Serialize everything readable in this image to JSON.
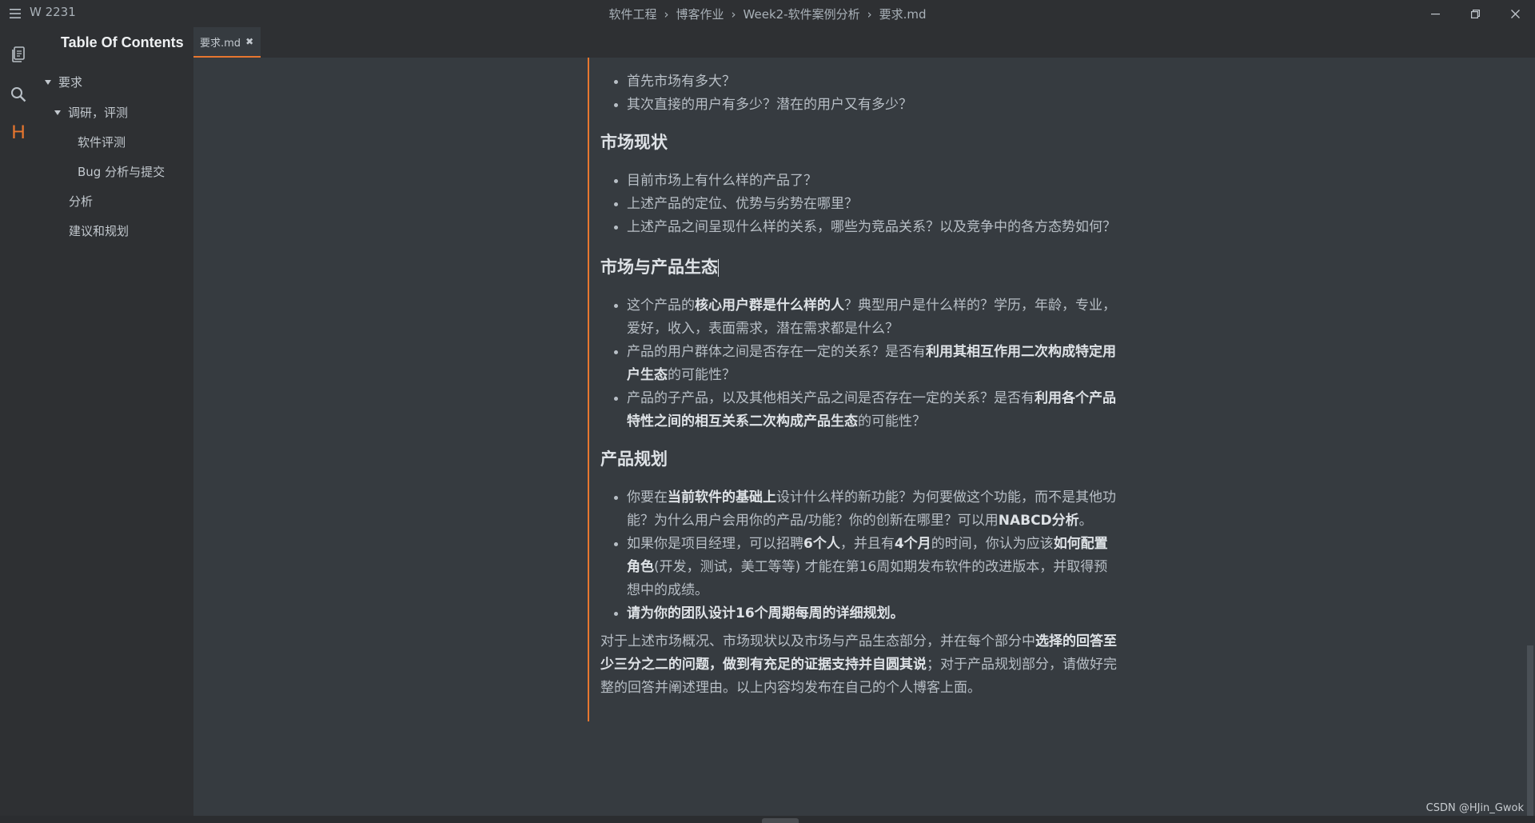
{
  "window": {
    "title": "W 2231",
    "breadcrumb": [
      "软件工程",
      "博客作业",
      "Week2-软件案例分析",
      "要求.md"
    ]
  },
  "sidebar": {
    "title": "Table Of Contents",
    "items": [
      {
        "label": "要求",
        "level": 1,
        "expanded": true
      },
      {
        "label": "调研，评测",
        "level": 2,
        "expanded": true
      },
      {
        "label": "软件评测",
        "level": 3
      },
      {
        "label": "Bug 分析与提交",
        "level": 3
      },
      {
        "label": "分析",
        "level": 2
      },
      {
        "label": "建议和规划",
        "level": 2
      }
    ]
  },
  "activity_icons": [
    "files-icon",
    "search-icon",
    "heading-icon",
    "settings-icon"
  ],
  "tab": {
    "label": "要求.md",
    "close": "✖"
  },
  "doc": {
    "list1": [
      "首先市场有多大？",
      "其次直接的用户有多少？潜在的用户又有多少？"
    ],
    "h_market_status": "市场现状",
    "list2": [
      "目前市场上有什么样的产品了？",
      "上述产品的定位、优势与劣势在哪里？",
      "上述产品之间呈现什么样的关系，哪些为竞品关系？以及竞争中的各方态势如何？"
    ],
    "h_ecosystem": "市场与产品生态",
    "eco1": {
      "a": "这个产品的",
      "b": "核心用户群是什么样的人",
      "c": "？典型用户是什么样的？学历，年龄，专业，爱好，收入，表面需求，潜在需求都是什么？"
    },
    "eco2": {
      "a": "产品的用户群体之间是否存在一定的关系？是否有",
      "b": "利用其相互作用二次构成特定用户生态",
      "c": "的可能性？"
    },
    "eco3": {
      "a": "产品的子产品，以及其他相关产品之间是否存在一定的关系？是否有",
      "b": "利用各个产品特性之间的相互关系二次构成产品生态",
      "c": "的可能性？"
    },
    "h_plan": "产品规划",
    "plan1": {
      "a": "你要在",
      "b": "当前软件的基础上",
      "c": "设计什么样的新功能？为何要做这个功能，而不是其他功能？为什么用户会用你的产品/功能？你的创新在哪里？可以用",
      "d": "NABCD分析",
      "e": "。"
    },
    "plan2": {
      "a": "如果你是项目经理，可以招聘",
      "b": "6个人",
      "c": "，并且有",
      "d": "4个月",
      "e": "的时间，你认为应该",
      "f": "如何配置角色",
      "g": "(开发，测试，美工等等) 才能在第16周如期发布软件的改进版本，并取得预想中的成绩。"
    },
    "plan3": "请为你的团队设计16个周期每周的详细规划。",
    "para": {
      "a": "对于上述市场概况、市场现状以及市场与产品生态部分，并在每个部分中",
      "b": "选择的回答至少三分之二的问题，做到有充足的证据支持并自圆其说",
      "c": "；对于产品规划部分，请做好完整的回答并阐述理由。以上内容均发布在自己的个人博客上面。"
    }
  },
  "watermark": "CSDN @HJin_Gwok",
  "colors": {
    "accent": "#e7762f",
    "bg": "#363b40",
    "panel": "#2e3033",
    "text": "#b8bfc6"
  }
}
